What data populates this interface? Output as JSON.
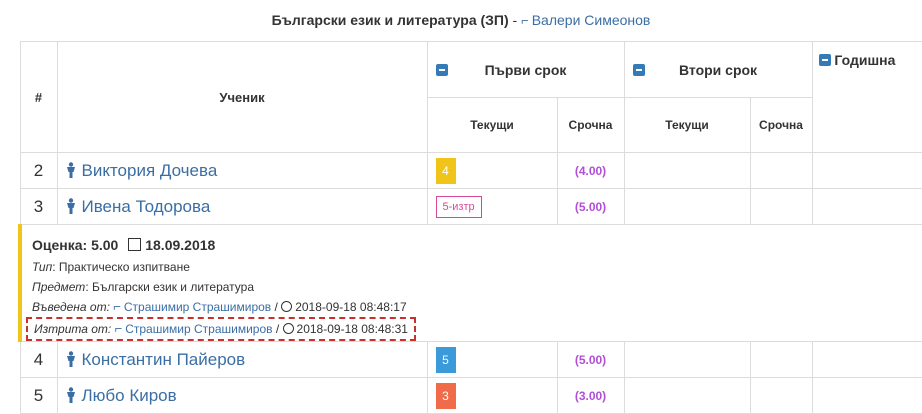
{
  "header": {
    "subject": "Български език и литература (ЗП)",
    "separator": "-",
    "teacher": "Валери Симеонов"
  },
  "table": {
    "col_num": "#",
    "col_student": "Ученик",
    "term1": "Първи срок",
    "term2": "Втори срок",
    "yearly": "Годишна",
    "sub_current": "Текущи",
    "sub_term": "Срочна",
    "rows": [
      {
        "num": "2",
        "name": "Виктория Дочева",
        "grade": "4",
        "grade_color": "#f0c419",
        "avg": "(4.00)"
      },
      {
        "num": "3",
        "name": "Ивена Тодорова",
        "grade": "5-изтр",
        "grade_color": "#d9479b",
        "avg": "(5.00)"
      },
      {
        "num": "4",
        "name": "Константин Пайеров",
        "grade": "5",
        "grade_color": "#3b9ad9",
        "avg": "(5.00)"
      },
      {
        "num": "5",
        "name": "Любо Киров",
        "grade": "3",
        "grade_color": "#ef6b4a",
        "avg": "(3.00)"
      }
    ]
  },
  "detail": {
    "grade_label": "Оценка: 5.00",
    "date": "18.09.2018",
    "type_label": "Тип",
    "type_value": ": Практическо изпитване",
    "subject_label": "Предмет",
    "subject_value": ": Български език и литература",
    "entered_label": "Въведена от:",
    "entered_by": "Страшимир Страшимиров",
    "entered_sep": " /",
    "entered_at": "2018-09-18 08:48:17",
    "deleted_label": "Изтрита от:",
    "deleted_by": "Страшимир Страшимиров",
    "deleted_sep": " /",
    "deleted_at": "2018-09-18 08:48:31",
    "accent_color": "#f0c419",
    "highlight_color": "#c9302c"
  }
}
